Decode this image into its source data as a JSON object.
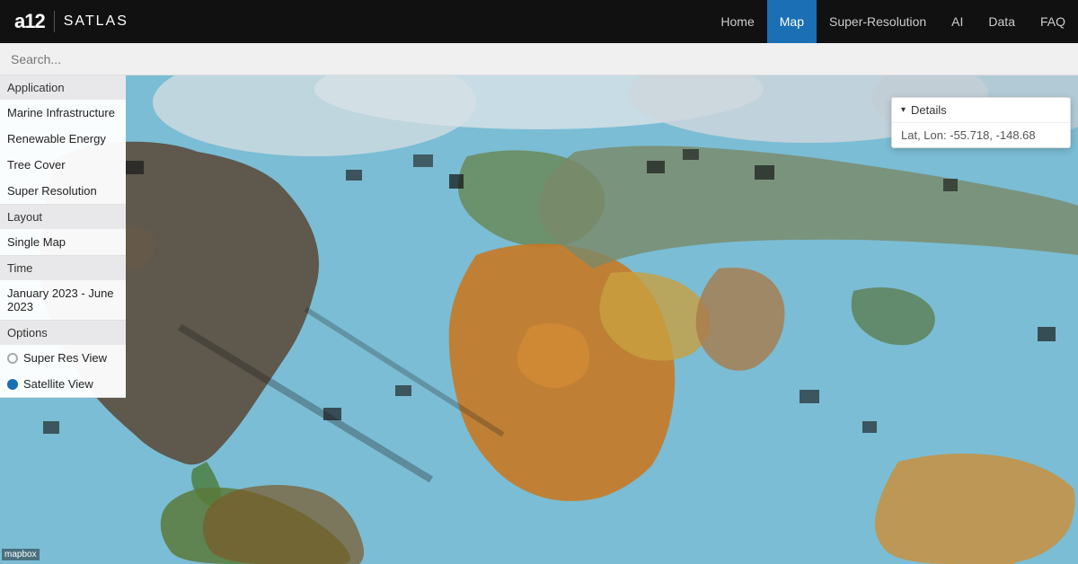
{
  "navbar": {
    "logo_a12": "a12",
    "logo_satlas": "SATLAS",
    "nav_links": [
      {
        "label": "Home",
        "active": false
      },
      {
        "label": "Map",
        "active": true
      },
      {
        "label": "Super-Resolution",
        "active": false
      },
      {
        "label": "AI",
        "active": false
      },
      {
        "label": "Data",
        "active": false
      },
      {
        "label": "FAQ",
        "active": false
      }
    ]
  },
  "searchbar": {
    "placeholder": "Search..."
  },
  "left_panel": {
    "application_header": "Application",
    "application_items": [
      {
        "label": "Marine Infrastructure"
      },
      {
        "label": "Renewable Energy"
      },
      {
        "label": "Tree Cover"
      },
      {
        "label": "Super Resolution"
      }
    ],
    "layout_header": "Layout",
    "layout_items": [
      {
        "label": "Single Map"
      }
    ],
    "time_header": "Time",
    "time_value": "January 2023 - June 2023",
    "options_header": "Options",
    "options_items": [
      {
        "label": "Super Res View",
        "selected": false
      },
      {
        "label": "Satellite View",
        "selected": true
      }
    ]
  },
  "details_popup": {
    "header": "Details",
    "lat_lon_label": "Lat, Lon:",
    "lat_lon_value": "-55.718, -148.68"
  },
  "attribution": {
    "text": "mapbox"
  }
}
